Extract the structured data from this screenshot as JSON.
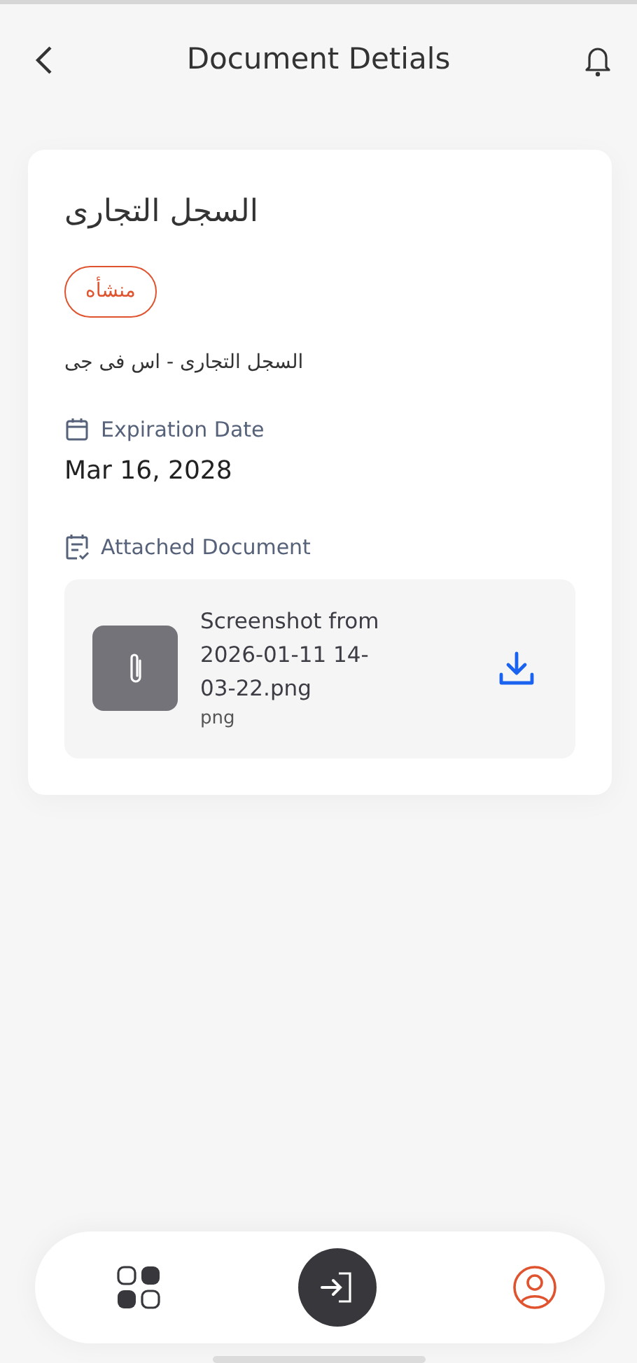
{
  "header": {
    "title": "Document Detials"
  },
  "document": {
    "title": "السجل التجارى",
    "status": "منشأه",
    "subtitle": "السجل التجارى - اس فى جى",
    "expiration_label": "Expiration Date",
    "expiration_date": "Mar 16, 2028",
    "attachment_label": "Attached Document",
    "attachment": {
      "file_name": "Screenshot from 2026-01-11 14-03-22.png",
      "file_type": "png"
    }
  },
  "bottom_nav": [
    {
      "kind": "grid",
      "selected": false
    },
    {
      "kind": "action",
      "selected": false
    },
    {
      "kind": "profile",
      "selected": true
    }
  ]
}
